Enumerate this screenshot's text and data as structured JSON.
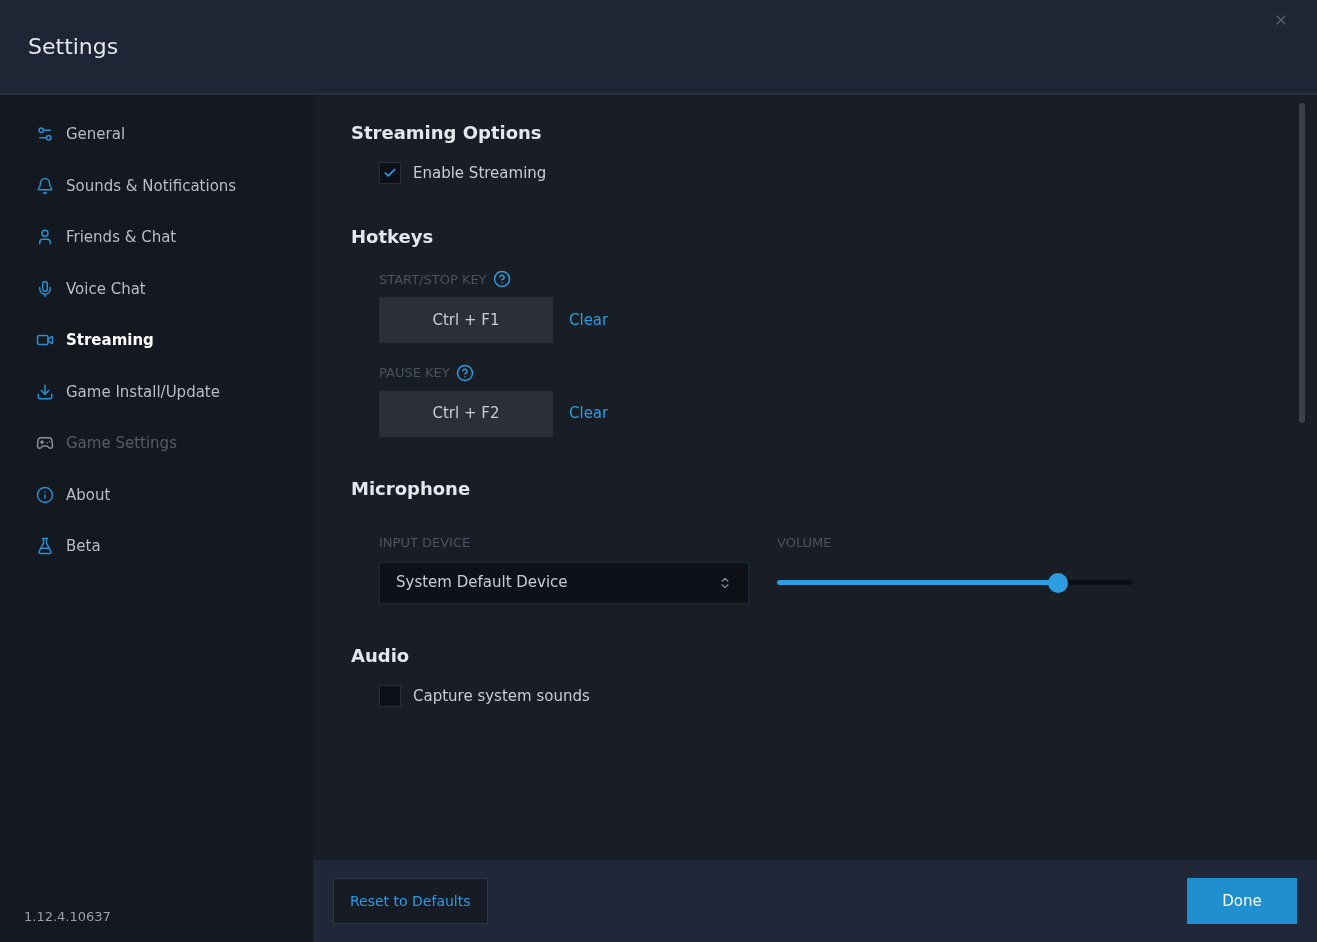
{
  "window": {
    "title": "Settings"
  },
  "sidebar": {
    "items": [
      {
        "label": "General",
        "selected": false,
        "disabled": false
      },
      {
        "label": "Sounds & Notifications",
        "selected": false,
        "disabled": false
      },
      {
        "label": "Friends & Chat",
        "selected": false,
        "disabled": false
      },
      {
        "label": "Voice Chat",
        "selected": false,
        "disabled": false
      },
      {
        "label": "Streaming",
        "selected": true,
        "disabled": false
      },
      {
        "label": "Game Install/Update",
        "selected": false,
        "disabled": false
      },
      {
        "label": "Game Settings",
        "selected": false,
        "disabled": true
      },
      {
        "label": "About",
        "selected": false,
        "disabled": false
      },
      {
        "label": "Beta",
        "selected": false,
        "disabled": false
      }
    ],
    "version": "1.12.4.10637"
  },
  "sections": [
    {
      "title": "Streaming Options",
      "controls": [
        {
          "kind": "checkbox",
          "label": "Enable Streaming",
          "checked": true
        }
      ]
    },
    {
      "title": "Hotkeys",
      "controls": [
        {
          "kind": "hotkey",
          "label": "START/STOP KEY",
          "value": "Ctrl + F1",
          "action": "Clear"
        },
        {
          "kind": "hotkey",
          "label": "PAUSE KEY",
          "value": "Ctrl + F2",
          "action": "Clear"
        }
      ]
    },
    {
      "title": "Microphone",
      "controls": [
        {
          "kind": "device",
          "label": "INPUT DEVICE",
          "value": "System Default Device",
          "volume_label": "VOLUME",
          "level": 0.79
        }
      ]
    },
    {
      "title": "Audio",
      "controls": [
        {
          "kind": "checkbox",
          "label": "Capture system sounds",
          "checked": false
        }
      ]
    }
  ],
  "footer": {
    "reset": "Reset to Defaults",
    "done": "Done"
  }
}
